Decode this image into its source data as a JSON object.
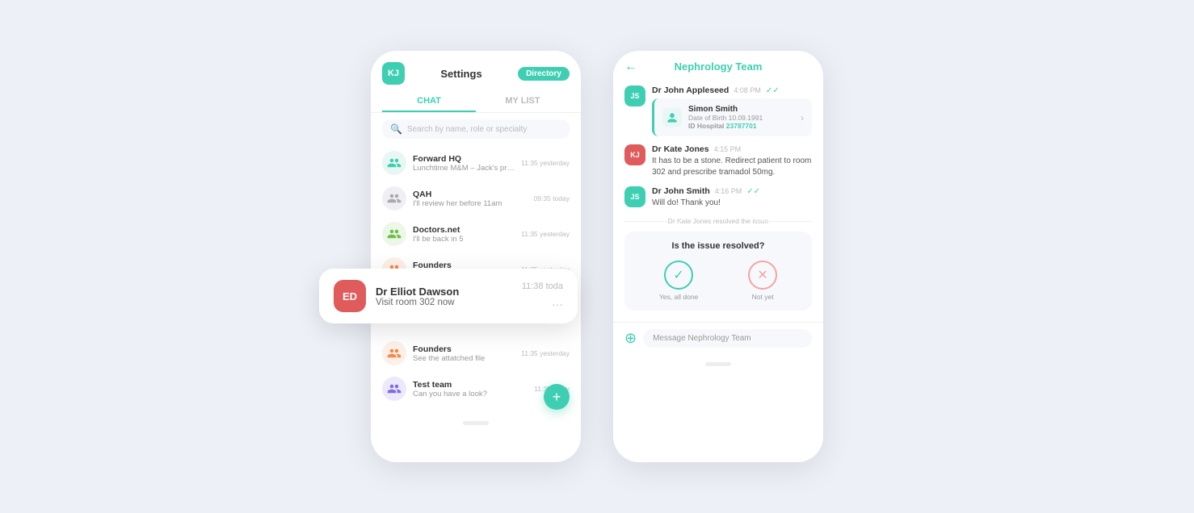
{
  "scene": {
    "bg": "#eef0f8"
  },
  "left_phone": {
    "header": {
      "badge_initials": "KJ",
      "badge_color": "teal",
      "title": "Settings",
      "directory_label": "Directory"
    },
    "tabs": [
      {
        "label": "CHAT",
        "active": true
      },
      {
        "label": "MY LIST",
        "active": false
      }
    ],
    "search_placeholder": "Search by name, role or specialty",
    "chat_items": [
      {
        "name": "Forward HQ",
        "preview": "Lunchtime M&M – Jack's presenting!",
        "time": "11:35 yesterday",
        "avatar_color": "teal",
        "icon": "group"
      },
      {
        "name": "QAH",
        "preview": "I'll review her before 11am",
        "time": "09:35 today",
        "avatar_color": "gray",
        "icon": "group"
      },
      {
        "name": "Doctors.net",
        "preview": "I'll be back in 5",
        "time": "11:35 yesterday",
        "avatar_color": "green",
        "icon": "group"
      },
      {
        "name": "Founders",
        "preview": "See the attatched file",
        "time": "11:35 yesterday",
        "avatar_color": "orange",
        "icon": "group"
      },
      {
        "name": "Founders",
        "preview": "See the attatched file",
        "time": "11:35 yesterday",
        "avatar_color": "orange",
        "icon": "group"
      },
      {
        "name": "Test team",
        "preview": "Can you have a look?",
        "time": "11:35 today",
        "avatar_color": "purple",
        "icon": "group"
      }
    ]
  },
  "notification": {
    "initials": "ED",
    "name": "Dr Elliot Dawson",
    "message": "Visit room 302 now",
    "time": "11:38 toda"
  },
  "right_phone": {
    "title": "Nephrology Team",
    "messages": [
      {
        "sender": "Dr John Appleseed",
        "initials": "JS",
        "avatar_color": "teal",
        "time": "4:08 PM",
        "check": true,
        "type": "patient_card",
        "patient": {
          "name": "Simon Smith",
          "dob_label": "Date of Birth",
          "dob": "10.09.1991",
          "id_label": "ID Hospital",
          "id": "23787701"
        }
      },
      {
        "sender": "Dr Kate Jones",
        "initials": "KJ",
        "avatar_color": "red",
        "time": "4:15 PM",
        "check": false,
        "type": "text",
        "text": "It has to be a stone. Redirect patient to room 302 and prescribe tramadol 50mg."
      },
      {
        "sender": "Dr John Smith",
        "initials": "JS",
        "avatar_color": "teal",
        "time": "4:16 PM",
        "check": true,
        "type": "text",
        "text": "Will do! Thank you!"
      }
    ],
    "divider_text": "Dr Kate Jones resolved the issue",
    "resolve": {
      "question": "Is the issue resolved?",
      "yes_label": "Yes, all done",
      "no_label": "Not yet"
    },
    "input_placeholder": "Message Nephrology Team"
  }
}
